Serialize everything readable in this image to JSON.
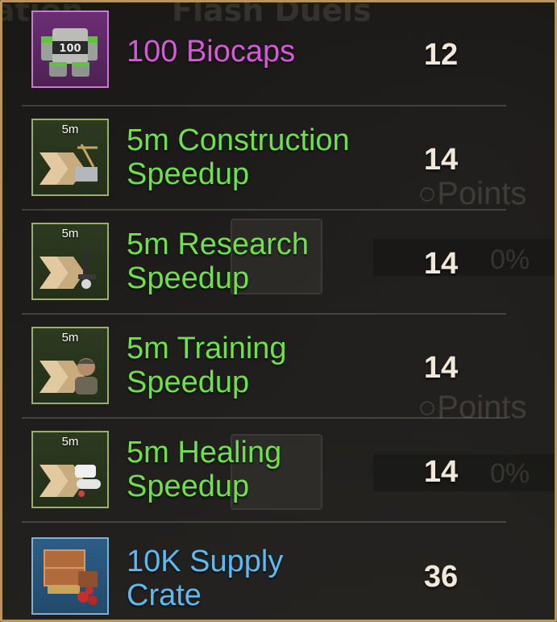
{
  "rewards": [
    {
      "icon_tag": "",
      "icon": "biocaps-icon",
      "name_line1": "100 Biocaps",
      "name_line2": "",
      "value": "12",
      "rarity_color": "#d65ad8"
    },
    {
      "icon_tag": "5m",
      "icon": "construction-speedup-icon",
      "name_line1": "5m Construction",
      "name_line2": "Speedup",
      "value": "14",
      "rarity_color": "#6fe04a"
    },
    {
      "icon_tag": "5m",
      "icon": "research-speedup-icon",
      "name_line1": "5m Research",
      "name_line2": "Speedup",
      "value": "14",
      "rarity_color": "#6fe04a"
    },
    {
      "icon_tag": "5m",
      "icon": "training-speedup-icon",
      "name_line1": "5m Training",
      "name_line2": "Speedup",
      "value": "14",
      "rarity_color": "#6fe04a"
    },
    {
      "icon_tag": "5m",
      "icon": "healing-speedup-icon",
      "name_line1": "5m Healing",
      "name_line2": "Speedup",
      "value": "14",
      "rarity_color": "#6fe04a"
    },
    {
      "icon_tag": "",
      "icon": "supply-crate-icon",
      "name_line1": "10K Supply",
      "name_line2": "Crate",
      "value": "36",
      "rarity_color": "#5bb9f4"
    }
  ],
  "biocaps_label": "100"
}
